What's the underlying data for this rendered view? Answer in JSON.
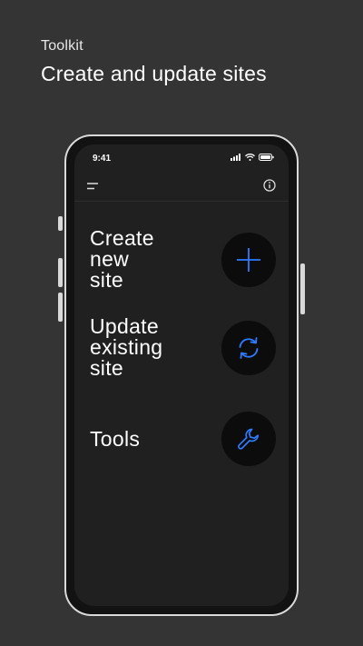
{
  "header": {
    "eyebrow": "Toolkit",
    "title": "Create and update sites"
  },
  "phone": {
    "status_bar": {
      "time": "9:41"
    },
    "actions": [
      {
        "label": "Create\nnew\nsite",
        "icon": "plus-icon"
      },
      {
        "label": "Update\nexisting\nsite",
        "icon": "refresh-icon"
      },
      {
        "label": "Tools",
        "icon": "wrench-icon"
      }
    ],
    "accent_color": "#2f7bff"
  }
}
